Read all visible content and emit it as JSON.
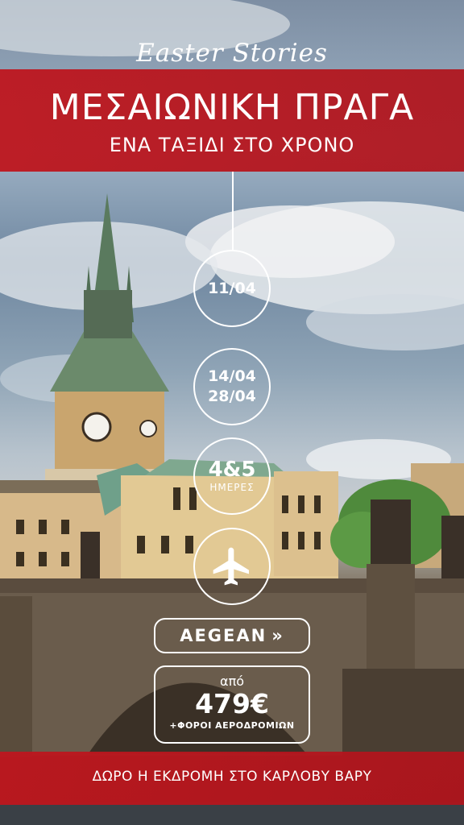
{
  "header": {
    "script_title": "Easter Stories",
    "title": "ΜΕΣΑΙΩΝΙΚΗ ΠΡΑΓΑ",
    "subtitle": "ΕΝΑ ΤΑΞΙΔΙ ΣΤΟ ΧΡΟΝΟ"
  },
  "timeline": {
    "date_1": "11/04",
    "date_2a": "14/04",
    "date_2b": "28/04",
    "duration_number": "4&5",
    "duration_label": "ΗΜΕΡΕΣ",
    "plane_icon": "airplane-icon"
  },
  "airline": {
    "name": "AEGEAN",
    "chevron": "»"
  },
  "price": {
    "from_label": "από",
    "amount": "479€",
    "taxes_note": "+ΦΟΡΟΙ ΑΕΡΟΔΡΟΜΙΩΝ"
  },
  "footer": {
    "text": "ΔΩΡΟ Η ΕΚΔΡΟΜΗ ΣΤΟ ΚΑΡΛΟΒΥ ΒΑΡΥ"
  },
  "colors": {
    "band_red": "#BE161E",
    "text_white": "#FFFFFF"
  }
}
